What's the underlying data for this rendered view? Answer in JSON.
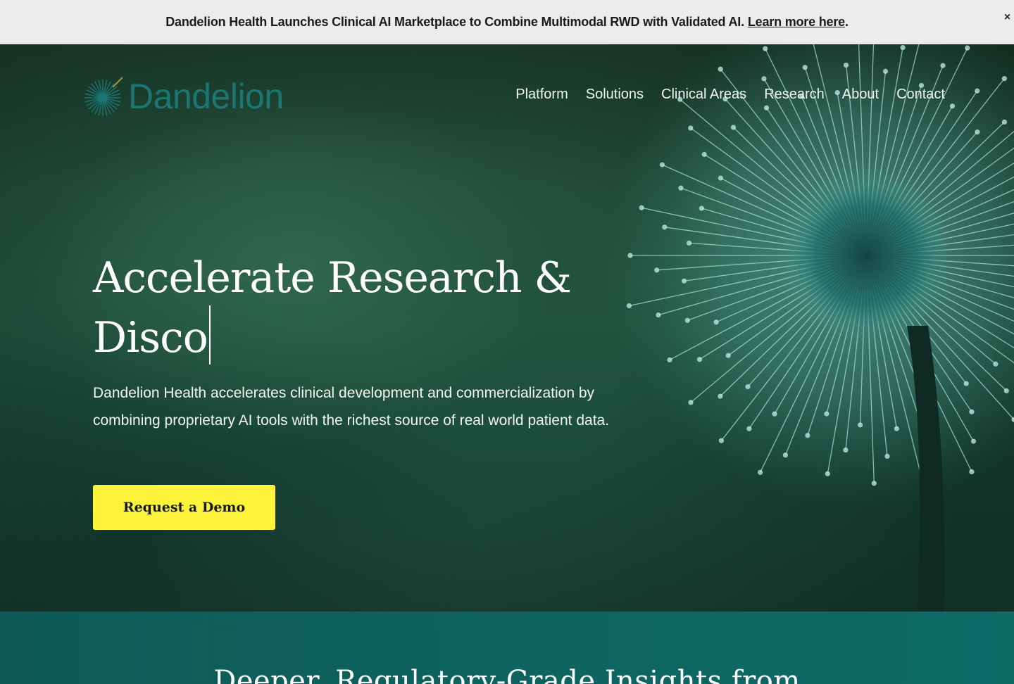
{
  "announcement": {
    "text": "Dandelion Health Launches Clinical AI Marketplace to Combine Multimodal RWD with Validated AI.",
    "link_label": "Learn more here",
    "period": ".",
    "close_label": "×"
  },
  "brand": {
    "name": "Dandelion",
    "color": "#1a8a8a",
    "logo_icon": "dandelion-seed-logo-icon"
  },
  "nav": {
    "items": [
      {
        "label": "Platform"
      },
      {
        "label": "Solutions"
      },
      {
        "label": "Clinical Areas"
      },
      {
        "label": "Research"
      },
      {
        "label": "About"
      },
      {
        "label": "Contact"
      }
    ]
  },
  "hero": {
    "headline_line1": "Accelerate Research &",
    "headline_line2": "Disco",
    "subcopy": "Dandelion Health accelerates clinical development and commercialization by combining proprietary AI tools with the richest source of real world patient data.",
    "cta_label": "Request a Demo",
    "cta_color": "#fdf33b"
  },
  "section2": {
    "heading": "Deeper, Regulatory-Grade Insights from"
  }
}
